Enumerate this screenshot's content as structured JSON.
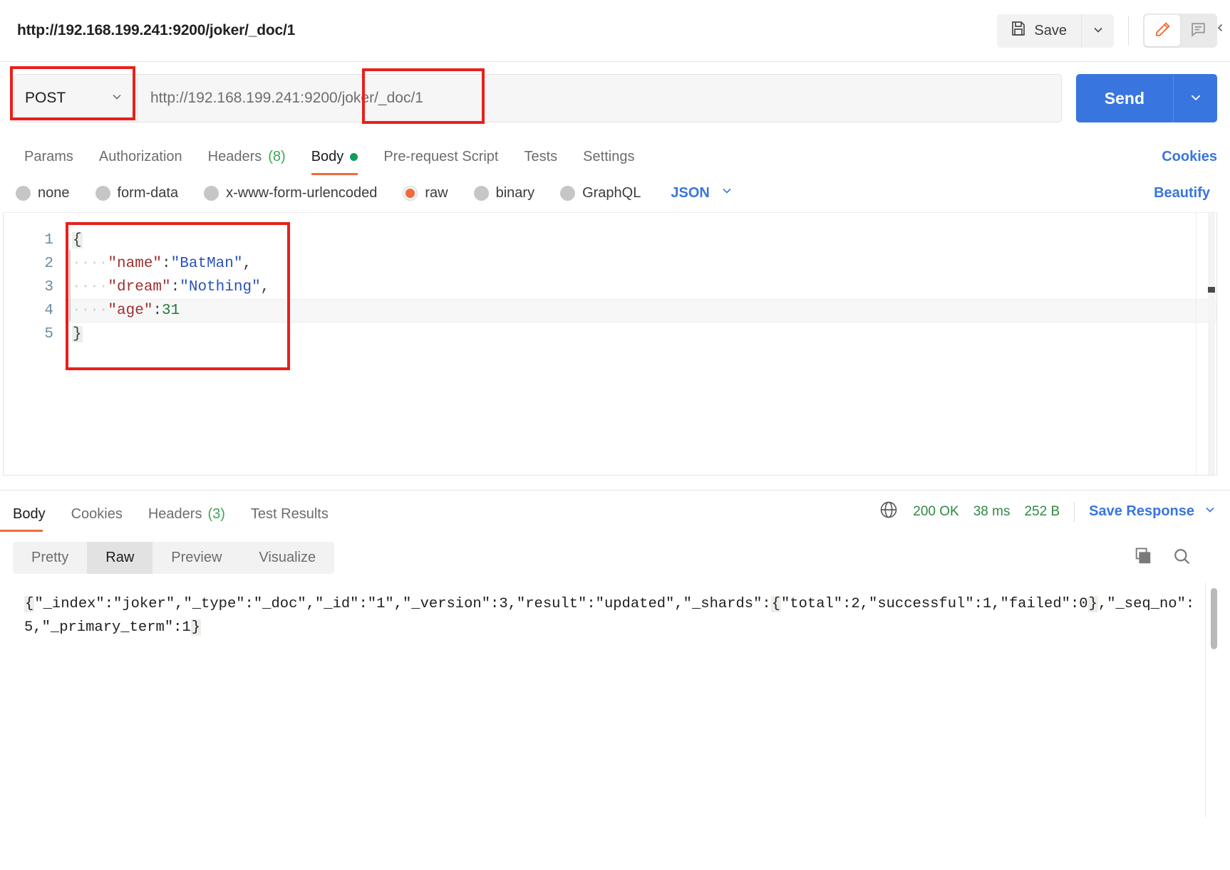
{
  "header": {
    "request_title": "http://192.168.199.241:9200/joker/_doc/1",
    "save_label": "Save",
    "save_icon": "floppy-disk-icon",
    "save_caret_icon": "chevron-down-icon",
    "edit_icon": "pencil-icon",
    "comment_icon": "comment-icon",
    "collapse_icon": "chevron-left-icon"
  },
  "url_bar": {
    "method": "POST",
    "method_caret_icon": "chevron-down-icon",
    "url": "http://192.168.199.241:9200/joker/_doc/1",
    "send_label": "Send",
    "send_caret_icon": "chevron-down-icon"
  },
  "request_tabs": {
    "items": [
      {
        "label": "Params",
        "count": "",
        "active": false
      },
      {
        "label": "Authorization",
        "count": "",
        "active": false
      },
      {
        "label": "Headers",
        "count": "(8)",
        "active": false
      },
      {
        "label": "Body",
        "count": "",
        "active": true
      },
      {
        "label": "Pre-request Script",
        "count": "",
        "active": false
      },
      {
        "label": "Tests",
        "count": "",
        "active": false
      },
      {
        "label": "Settings",
        "count": "",
        "active": false
      }
    ],
    "cookies_label": "Cookies"
  },
  "body_type": {
    "options": [
      {
        "label": "none",
        "selected": false
      },
      {
        "label": "form-data",
        "selected": false
      },
      {
        "label": "x-www-form-urlencoded",
        "selected": false
      },
      {
        "label": "raw",
        "selected": true
      },
      {
        "label": "binary",
        "selected": false
      },
      {
        "label": "GraphQL",
        "selected": false
      }
    ],
    "format": "JSON",
    "format_caret_icon": "chevron-down-icon",
    "beautify_label": "Beautify"
  },
  "editor": {
    "line_numbers": [
      "1",
      "2",
      "3",
      "4",
      "5"
    ],
    "lines": [
      {
        "indent": 0,
        "tokens": [
          {
            "t": "brace",
            "v": "{"
          }
        ]
      },
      {
        "indent": 4,
        "tokens": [
          {
            "t": "key",
            "v": "\"name\""
          },
          {
            "t": "punc",
            "v": ":"
          },
          {
            "t": "str",
            "v": "\"BatMan\""
          },
          {
            "t": "punc",
            "v": ","
          }
        ]
      },
      {
        "indent": 4,
        "tokens": [
          {
            "t": "key",
            "v": "\"dream\""
          },
          {
            "t": "punc",
            "v": ":"
          },
          {
            "t": "str",
            "v": "\"Nothing\""
          },
          {
            "t": "punc",
            "v": ","
          }
        ]
      },
      {
        "indent": 4,
        "tokens": [
          {
            "t": "key",
            "v": "\"age\""
          },
          {
            "t": "punc",
            "v": ":"
          },
          {
            "t": "num",
            "v": "31"
          }
        ]
      },
      {
        "indent": 0,
        "tokens": [
          {
            "t": "brace",
            "v": "}"
          }
        ]
      }
    ],
    "raw_text": "{\n    \"name\":\"BatMan\",\n    \"dream\":\"Nothing\",\n    \"age\":31\n}"
  },
  "response_tabs": {
    "items": [
      {
        "label": "Body",
        "count": "",
        "active": true
      },
      {
        "label": "Cookies",
        "count": "",
        "active": false
      },
      {
        "label": "Headers",
        "count": "(3)",
        "active": false
      },
      {
        "label": "Test Results",
        "count": "",
        "active": false
      }
    ],
    "globe_icon": "globe-icon",
    "status": "200 OK",
    "time": "38 ms",
    "size": "252 B",
    "save_response_label": "Save Response",
    "save_response_caret_icon": "chevron-down-icon"
  },
  "response_view": {
    "modes": [
      {
        "label": "Pretty",
        "active": false
      },
      {
        "label": "Raw",
        "active": true
      },
      {
        "label": "Preview",
        "active": false
      },
      {
        "label": "Visualize",
        "active": false
      }
    ],
    "copy_icon": "copy-icon",
    "search_icon": "search-icon"
  },
  "response_body": {
    "text": "{\"_index\":\"joker\",\"_type\":\"_doc\",\"_id\":\"1\",\"_version\":3,\"result\":\"updated\",\"_shards\":{\"total\":2,\"successful\":1,\"failed\":0},\"_seq_no\":5,\"_primary_term\":1}",
    "opening_brace": "{",
    "middle": "\"_index\":\"joker\",\"_type\":\"_doc\",\"_id\":\"1\",\"_version\":3,\"result\":\"updated\",\"_shards\":",
    "inner_open": "{",
    "inner_middle": "\"total\":2,\"successful\":1,\"failed\":0",
    "inner_close": "}",
    "tail": ",\"_seq_no\":5,\"_primary_term\":1",
    "closing_brace": "}"
  },
  "annotations": {
    "colors": {
      "highlight": "#e8201a",
      "accent": "#ef6b3a",
      "primary": "#3975de",
      "success": "#2f8a43"
    },
    "boxes": [
      {
        "name": "method-highlight"
      },
      {
        "name": "url-path-highlight"
      },
      {
        "name": "json-body-highlight"
      }
    ]
  }
}
